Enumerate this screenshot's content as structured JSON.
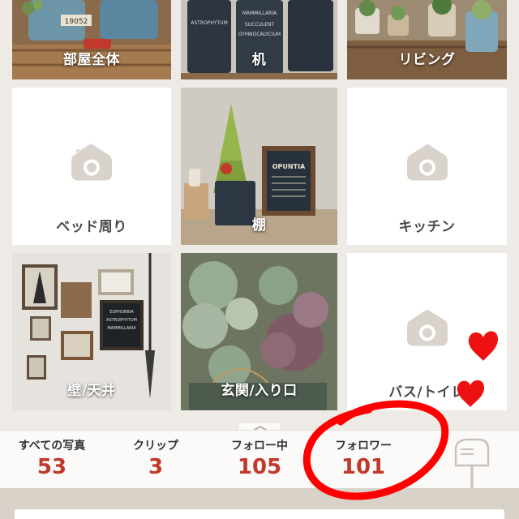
{
  "grid": {
    "tiles": [
      {
        "label": "部屋全体",
        "kind": "photo"
      },
      {
        "label": "机",
        "kind": "photo"
      },
      {
        "label": "リビング",
        "kind": "photo"
      },
      {
        "label": "ベッド周り",
        "kind": "placeholder",
        "icon": "camera-icon"
      },
      {
        "label": "棚",
        "kind": "photo"
      },
      {
        "label": "キッチン",
        "kind": "placeholder",
        "icon": "camera-icon"
      },
      {
        "label": "壁/天井",
        "kind": "photo"
      },
      {
        "label": "玄関/入り口",
        "kind": "photo"
      },
      {
        "label": "バス/トイレ",
        "kind": "placeholder",
        "icon": "camera-icon"
      }
    ],
    "photo_texts": {
      "can_1": "19052",
      "can_2_lines": [
        "EUPHORBIA",
        "ASTROPHYTUM",
        "MAMMILLARIA",
        "SUCCULENT",
        "GYMNOCALYCIUM"
      ],
      "sign": "OPUNTIA"
    }
  },
  "stats": [
    {
      "label": "すべての写真",
      "value": "53"
    },
    {
      "label": "クリップ",
      "value": "3"
    },
    {
      "label": "フォロー中",
      "value": "105"
    },
    {
      "label": "フォロワー",
      "value": "101"
    }
  ],
  "icons": {
    "expand_handle": "chevron-up-icon",
    "mailbox": "mailbox-icon"
  },
  "colors": {
    "stat_value": "#c0392b",
    "annotation": "#ff0000",
    "placeholder_icon": "#d9d3cc"
  },
  "annotations": {
    "circle_target": "フォロワー",
    "hearts": 2
  }
}
